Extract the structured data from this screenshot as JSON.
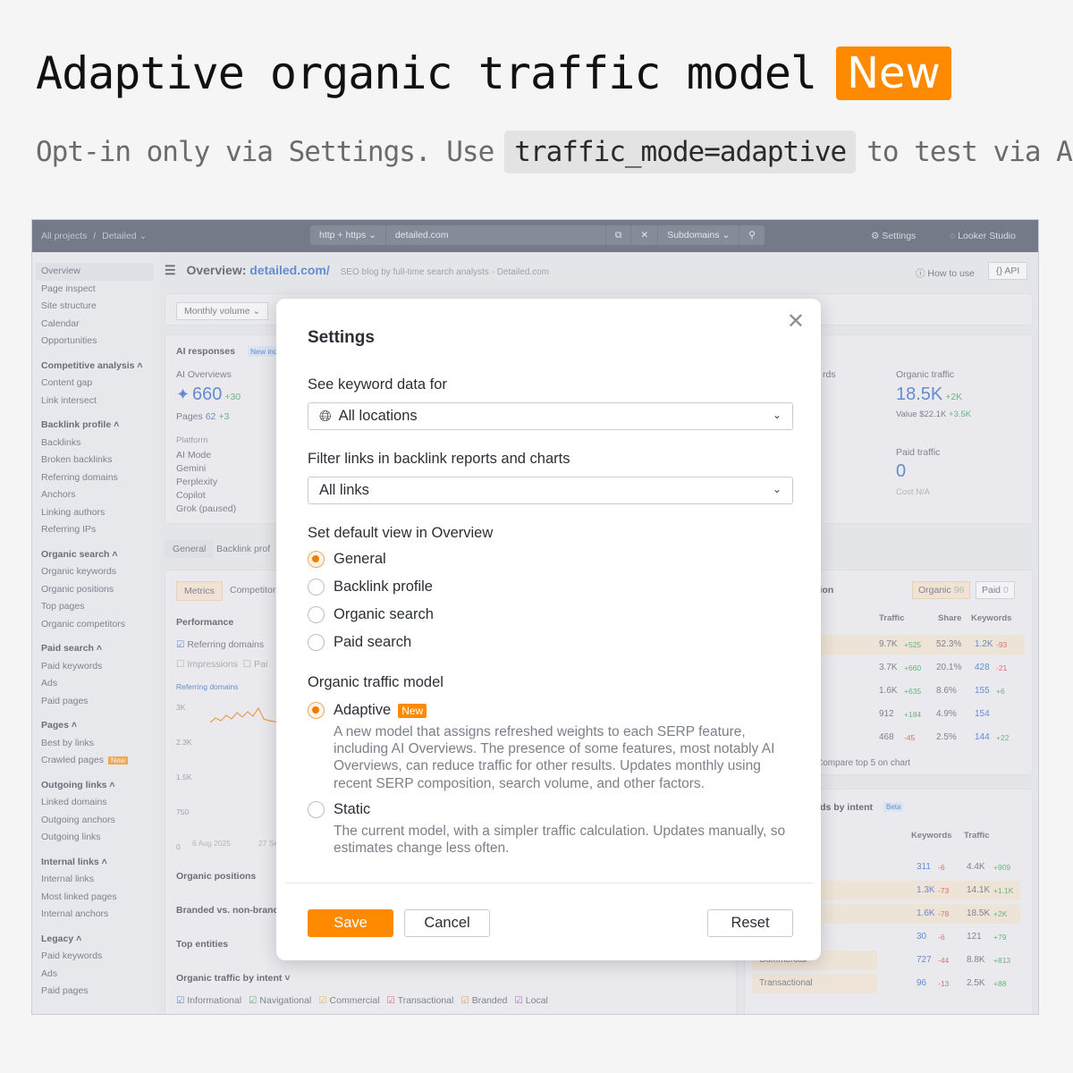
{
  "hero": {
    "title": "Adaptive organic traffic model",
    "badge": "New",
    "subtitle_pre": "Opt-in only via Settings. Use",
    "subtitle_code": "traffic_mode=adaptive",
    "subtitle_post": "to test via API"
  },
  "topbar": {
    "crumb_all": "All projects",
    "crumb_sep": "/",
    "crumb_project": "Detailed",
    "protocol": "http + https",
    "domain": "detailed.com",
    "scope": "Subdomains",
    "settings": "Settings",
    "looker": "Looker Studio"
  },
  "sidebar": {
    "items": [
      {
        "label": "Overview",
        "type": "active"
      },
      {
        "label": "Page inspect",
        "type": "item"
      },
      {
        "label": "Site structure",
        "type": "item"
      },
      {
        "label": "Calendar",
        "type": "item"
      },
      {
        "label": "Opportunities",
        "type": "item"
      },
      {
        "label": "Competitive analysis ˄",
        "type": "group"
      },
      {
        "label": "Content gap",
        "type": "item"
      },
      {
        "label": "Link intersect",
        "type": "item"
      },
      {
        "label": "Backlink profile ˄",
        "type": "group"
      },
      {
        "label": "Backlinks",
        "type": "item"
      },
      {
        "label": "Broken backlinks",
        "type": "item"
      },
      {
        "label": "Referring domains",
        "type": "item"
      },
      {
        "label": "Anchors",
        "type": "item"
      },
      {
        "label": "Linking authors",
        "type": "item"
      },
      {
        "label": "Referring IPs",
        "type": "item"
      },
      {
        "label": "Organic search ˄",
        "type": "group"
      },
      {
        "label": "Organic keywords",
        "type": "item"
      },
      {
        "label": "Organic positions",
        "type": "item"
      },
      {
        "label": "Top pages",
        "type": "item"
      },
      {
        "label": "Organic competitors",
        "type": "item"
      },
      {
        "label": "Paid search ˄",
        "type": "group"
      },
      {
        "label": "Paid keywords",
        "type": "item"
      },
      {
        "label": "Ads",
        "type": "item"
      },
      {
        "label": "Paid pages",
        "type": "item"
      },
      {
        "label": "Pages ˄",
        "type": "group"
      },
      {
        "label": "Best by links",
        "type": "item"
      },
      {
        "label": "Crawled pages",
        "type": "item"
      },
      {
        "label": "Outgoing links ˄",
        "type": "group"
      },
      {
        "label": "Linked domains",
        "type": "item"
      },
      {
        "label": "Outgoing anchors",
        "type": "item"
      },
      {
        "label": "Outgoing links",
        "type": "item"
      },
      {
        "label": "Internal links ˄",
        "type": "group"
      },
      {
        "label": "Internal links",
        "type": "item"
      },
      {
        "label": "Most linked pages",
        "type": "item"
      },
      {
        "label": "Internal anchors",
        "type": "item"
      },
      {
        "label": "Legacy ˄",
        "type": "group"
      },
      {
        "label": "Paid keywords",
        "type": "item"
      },
      {
        "label": "Ads",
        "type": "item"
      },
      {
        "label": "Paid pages",
        "type": "item"
      }
    ],
    "new_badge": "New"
  },
  "overview": {
    "title": "Overview:",
    "domain": "detailed.com/",
    "subtitle": "SEO blog by full-time search analysts - Detailed.com",
    "how_to": "How to use",
    "api": "API",
    "monthly": "Monthly volume",
    "ai_responses": "AI responses",
    "ai_new": "New inde",
    "ai_overviews": "AI Overviews",
    "ai_value": "660",
    "ai_delta": "+30",
    "pages_label": "Pages",
    "pages_value": "62",
    "pages_delta": "+3",
    "platform": "Platform",
    "platforms": [
      "AI Mode",
      "Gemini",
      "Perplexity",
      "Copilot",
      "Grok (paused)"
    ],
    "rds": "rds",
    "organic_traffic": "Organic traffic",
    "organic_value": "18.5K",
    "organic_delta": "+2K",
    "value_label": "Value",
    "value_amount": "$22.1K",
    "value_delta": "+3.5K",
    "paid_traffic": "Paid traffic",
    "paid_value": "0",
    "cost": "Cost N/A",
    "tab_general": "General",
    "tab_backlink": "Backlink prof",
    "metrics": "Metrics",
    "competitors": "Competitor",
    "performance": "Performance",
    "ref_domains": "Referring domains",
    "impressions": "Impressions",
    "pa": "Pai",
    "chart_legend": "Referring domains",
    "y_labels": [
      "3K",
      "2.3K",
      "1.5K",
      "750",
      "0"
    ],
    "x_labels": [
      "6 Aug 2025",
      "27 Se"
    ],
    "organic_positions": "Organic positions",
    "branded": "Branded vs. non-brand",
    "top_entities": "Top entities",
    "traffic_by_intent": "Organic traffic by intent ˅",
    "intents": [
      "Informational",
      "Navigational",
      "Commercial",
      "Transactional",
      "Branded",
      "Local"
    ],
    "tion": "tion",
    "organic_tab": "Organic",
    "organic_count": "96",
    "paid_tab": "Paid",
    "paid_count": "0",
    "cols": [
      "Traffic",
      "Share",
      "Keywords"
    ],
    "rows": [
      {
        "traffic": "9.7K",
        "td": "+525",
        "share": "52.3%",
        "kw": "1.2K",
        "kd": "-93"
      },
      {
        "traffic": "3.7K",
        "td": "+660",
        "share": "20.1%",
        "kw": "428",
        "kd": "-21"
      },
      {
        "traffic": "1.6K",
        "td": "+635",
        "share": "8.6%",
        "kw": "155",
        "kd": "+6"
      },
      {
        "traffic": "912",
        "td": "+184",
        "share": "4.9%",
        "kw": "154",
        "kd": ""
      },
      {
        "traffic": "468",
        "td": "-45",
        "share": "2.5%",
        "kw": "144",
        "kd": "+22"
      }
    ],
    "compare": "Compare top 5 on chart",
    "by_intent": "rds by intent",
    "beta": "Beta",
    "cols2": [
      "Keywords",
      "Traffic"
    ],
    "rows2": [
      {
        "label": "",
        "kw": "311",
        "kd": "-6",
        "tr": "4.4K",
        "trd": "+909"
      },
      {
        "label": "",
        "kw": "1.3K",
        "kd": "-73",
        "tr": "14.1K",
        "trd": "+1.1K"
      },
      {
        "label": "",
        "kw": "1.6K",
        "kd": "-78",
        "tr": "18.5K",
        "trd": "+2K"
      },
      {
        "label": "",
        "kw": "30",
        "kd": "-6",
        "tr": "121",
        "trd": "+79"
      },
      {
        "label": "Commercial",
        "kw": "727",
        "kd": "-44",
        "tr": "8.8K",
        "trd": "+813"
      },
      {
        "label": "Transactional",
        "kw": "96",
        "kd": "-13",
        "tr": "2.5K",
        "trd": "+88"
      }
    ]
  },
  "modal": {
    "title": "Settings",
    "keyword_label": "See keyword data for",
    "keyword_value": "All locations",
    "filter_label": "Filter links in backlink reports and charts",
    "filter_value": "All links",
    "default_label": "Set default view in Overview",
    "views": [
      "General",
      "Backlink profile",
      "Organic search",
      "Paid search"
    ],
    "model_label": "Organic traffic model",
    "adaptive": "Adaptive",
    "adaptive_badge": "New",
    "adaptive_desc": "A new model that assigns refreshed weights to each SERP feature, including AI Overviews. The presence of some features, most notably AI Overviews, can reduce traffic for other results. Updates monthly using recent SERP composition, search volume, and other factors.",
    "static": "Static",
    "static_desc": "The current model, with a simpler traffic calculation. Updates manually, so estimates change less often.",
    "save": "Save",
    "cancel": "Cancel",
    "reset": "Reset"
  },
  "colors": {
    "accent": "#ff8a00",
    "link": "#2462c8",
    "topbar": "#3c4656"
  }
}
